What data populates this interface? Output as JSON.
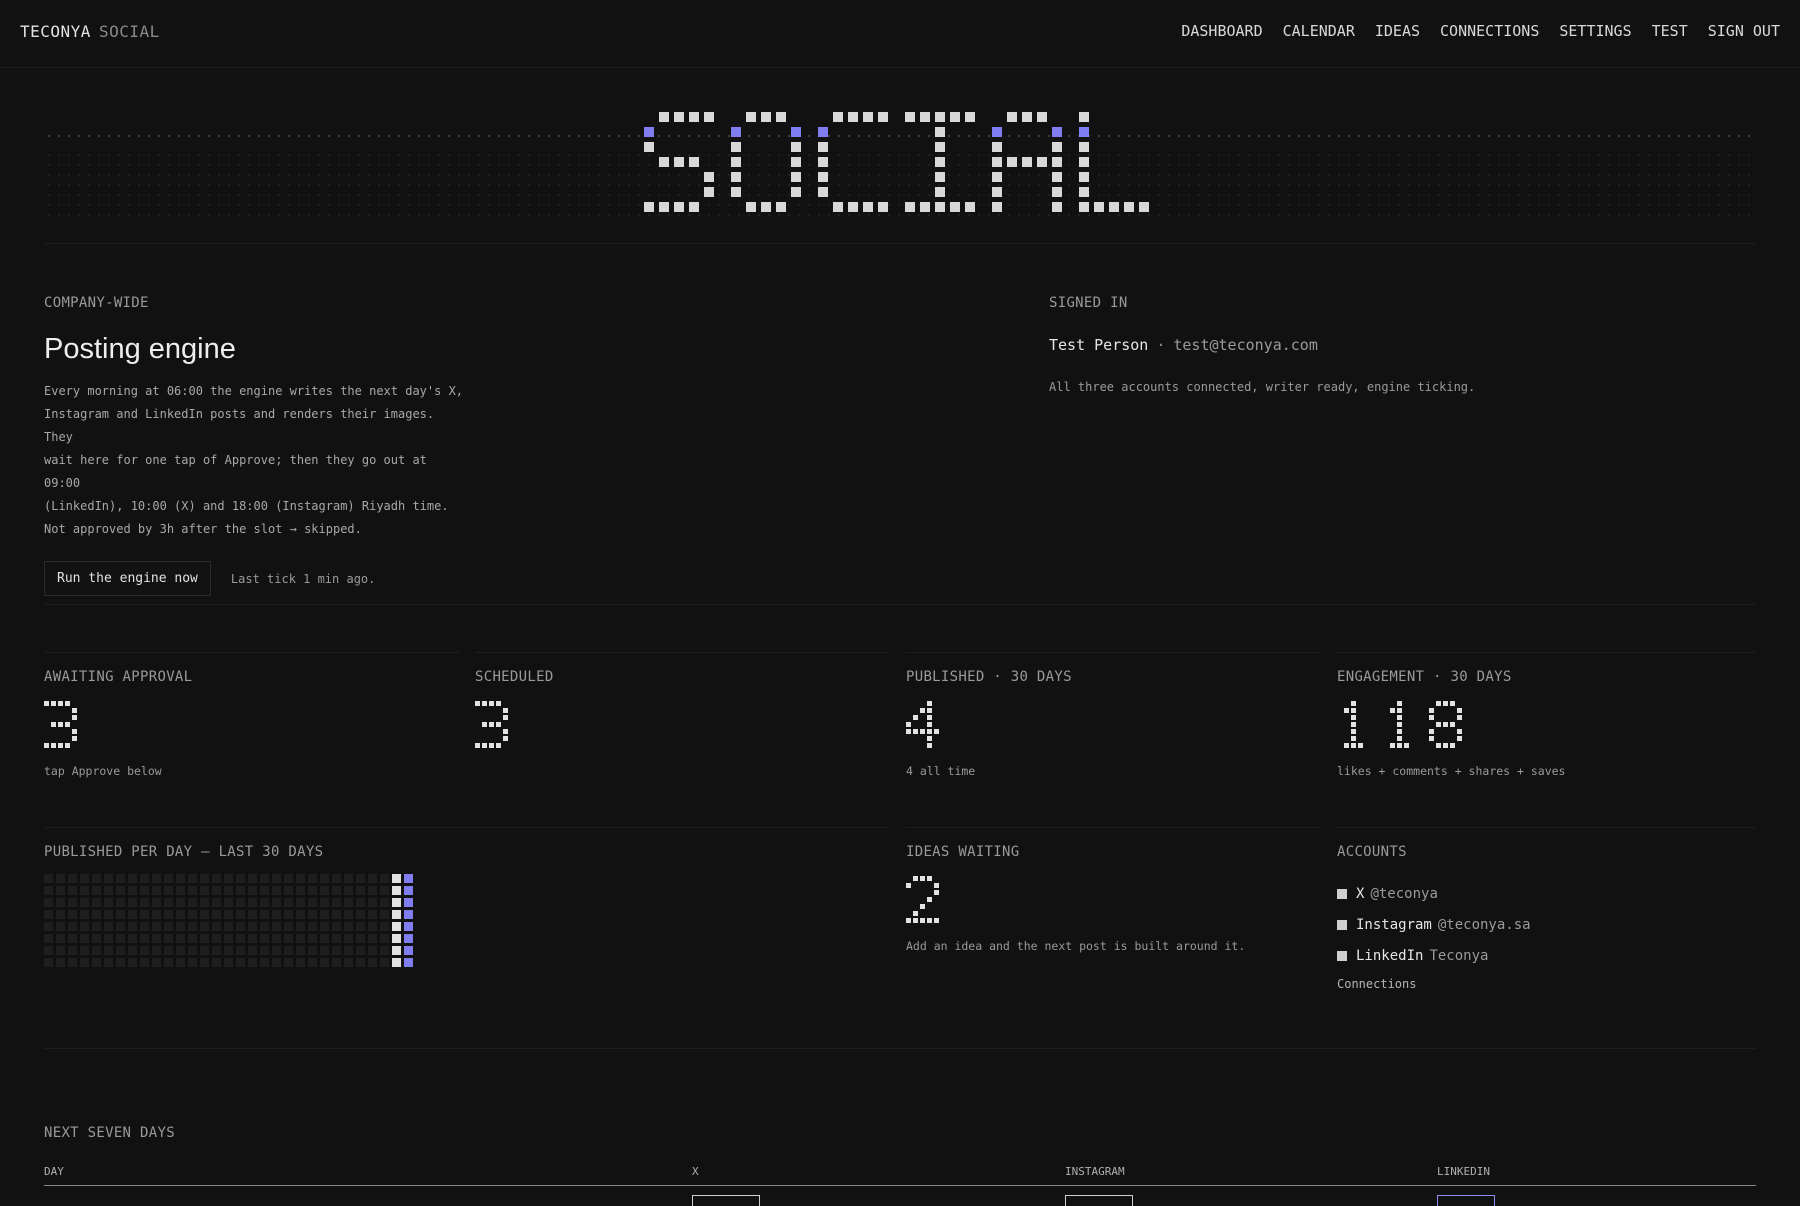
{
  "brand": {
    "name": "TECONYA",
    "product": "SOCIAL"
  },
  "nav": [
    "DASHBOARD",
    "CALENDAR",
    "IDEAS",
    "CONNECTIONS",
    "SETTINGS",
    "TEST",
    "SIGN OUT"
  ],
  "hero": {
    "logo_text": "SOCIAL",
    "accent": "#7f7df0",
    "pixel_color": "#d8d8d8"
  },
  "engine": {
    "kicker": "COMPANY-WIDE",
    "title": "Posting engine",
    "description_lines": [
      "Every morning at 06:00 the engine writes the next day's X,",
      "Instagram and LinkedIn posts and renders their images. They",
      "wait here for one tap of Approve; then they go out at 09:00",
      "(LinkedIn), 10:00 (X) and 18:00 (Instagram) Riyadh time.",
      "Not approved by 3h after the slot → skipped."
    ],
    "run_button": "Run the engine now",
    "last_tick": "Last tick 1 min ago."
  },
  "signed_in": {
    "kicker": "SIGNED IN",
    "name": "Test Person",
    "separator": "·",
    "email": "test@teconya.com",
    "status": "All three accounts connected, writer ready, engine ticking."
  },
  "stats": {
    "awaiting": {
      "label": "AWAITING APPROVAL",
      "value": "3",
      "caption": "tap Approve below"
    },
    "scheduled": {
      "label": "SCHEDULED",
      "value": "3",
      "caption": ""
    },
    "published": {
      "label": "PUBLISHED · 30 DAYS",
      "value": "4",
      "caption": "4 all time"
    },
    "engagement": {
      "label": "ENGAGEMENT · 30 DAYS",
      "value": "118",
      "caption": "likes + comments + shares + saves"
    }
  },
  "per_day": {
    "label": "PUBLISHED PER DAY — LAST 30 DAYS",
    "counts": [
      0,
      0,
      0,
      0,
      0,
      0,
      0,
      0,
      0,
      0,
      0,
      0,
      0,
      0,
      0,
      0,
      0,
      0,
      0,
      0,
      0,
      0,
      0,
      0,
      0,
      0,
      0,
      0,
      0,
      4
    ]
  },
  "ideas": {
    "label": "IDEAS WAITING",
    "value": "2",
    "caption": "Add an idea and the next post is built around it."
  },
  "accounts": {
    "label": "ACCOUNTS",
    "items": [
      {
        "name": "X",
        "handle": "@teconya"
      },
      {
        "name": "Instagram",
        "handle": "@teconya.sa"
      },
      {
        "name": "LinkedIn",
        "handle": "Teconya"
      }
    ],
    "link": "Connections"
  },
  "next_seven": {
    "label": "NEXT SEVEN DAYS",
    "columns": [
      "DAY",
      "X",
      "INSTAGRAM",
      "LINKEDIN"
    ]
  }
}
